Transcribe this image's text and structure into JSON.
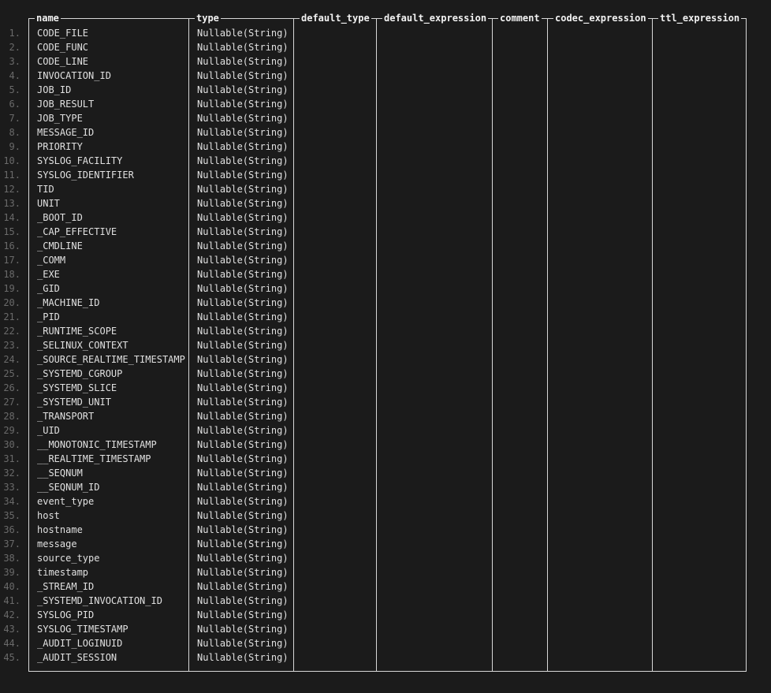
{
  "table": {
    "columns": [
      "name",
      "type",
      "default_type",
      "default_expression",
      "comment",
      "codec_expression",
      "ttl_expression"
    ],
    "rows": [
      [
        "CODE_FILE",
        "Nullable(String)"
      ],
      [
        "CODE_FUNC",
        "Nullable(String)"
      ],
      [
        "CODE_LINE",
        "Nullable(String)"
      ],
      [
        "INVOCATION_ID",
        "Nullable(String)"
      ],
      [
        "JOB_ID",
        "Nullable(String)"
      ],
      [
        "JOB_RESULT",
        "Nullable(String)"
      ],
      [
        "JOB_TYPE",
        "Nullable(String)"
      ],
      [
        "MESSAGE_ID",
        "Nullable(String)"
      ],
      [
        "PRIORITY",
        "Nullable(String)"
      ],
      [
        "SYSLOG_FACILITY",
        "Nullable(String)"
      ],
      [
        "SYSLOG_IDENTIFIER",
        "Nullable(String)"
      ],
      [
        "TID",
        "Nullable(String)"
      ],
      [
        "UNIT",
        "Nullable(String)"
      ],
      [
        "_BOOT_ID",
        "Nullable(String)"
      ],
      [
        "_CAP_EFFECTIVE",
        "Nullable(String)"
      ],
      [
        "_CMDLINE",
        "Nullable(String)"
      ],
      [
        "_COMM",
        "Nullable(String)"
      ],
      [
        "_EXE",
        "Nullable(String)"
      ],
      [
        "_GID",
        "Nullable(String)"
      ],
      [
        "_MACHINE_ID",
        "Nullable(String)"
      ],
      [
        "_PID",
        "Nullable(String)"
      ],
      [
        "_RUNTIME_SCOPE",
        "Nullable(String)"
      ],
      [
        "_SELINUX_CONTEXT",
        "Nullable(String)"
      ],
      [
        "_SOURCE_REALTIME_TIMESTAMP",
        "Nullable(String)"
      ],
      [
        "_SYSTEMD_CGROUP",
        "Nullable(String)"
      ],
      [
        "_SYSTEMD_SLICE",
        "Nullable(String)"
      ],
      [
        "_SYSTEMD_UNIT",
        "Nullable(String)"
      ],
      [
        "_TRANSPORT",
        "Nullable(String)"
      ],
      [
        "_UID",
        "Nullable(String)"
      ],
      [
        "__MONOTONIC_TIMESTAMP",
        "Nullable(String)"
      ],
      [
        "__REALTIME_TIMESTAMP",
        "Nullable(String)"
      ],
      [
        "__SEQNUM",
        "Nullable(String)"
      ],
      [
        "__SEQNUM_ID",
        "Nullable(String)"
      ],
      [
        "event_type",
        "Nullable(String)"
      ],
      [
        "host",
        "Nullable(String)"
      ],
      [
        "hostname",
        "Nullable(String)"
      ],
      [
        "message",
        "Nullable(String)"
      ],
      [
        "source_type",
        "Nullable(String)"
      ],
      [
        "timestamp",
        "Nullable(String)"
      ],
      [
        "_STREAM_ID",
        "Nullable(String)"
      ],
      [
        "_SYSTEMD_INVOCATION_ID",
        "Nullable(String)"
      ],
      [
        "SYSLOG_PID",
        "Nullable(String)"
      ],
      [
        "SYSLOG_TIMESTAMP",
        "Nullable(String)"
      ],
      [
        "_AUDIT_LOGINUID",
        "Nullable(String)"
      ],
      [
        "_AUDIT_SESSION",
        "Nullable(String)"
      ]
    ]
  },
  "colors": {
    "background": "#1b1b1b",
    "border": "#d8d8d8",
    "text": "#e0e0e0",
    "row_number": "#6a6a6a"
  }
}
